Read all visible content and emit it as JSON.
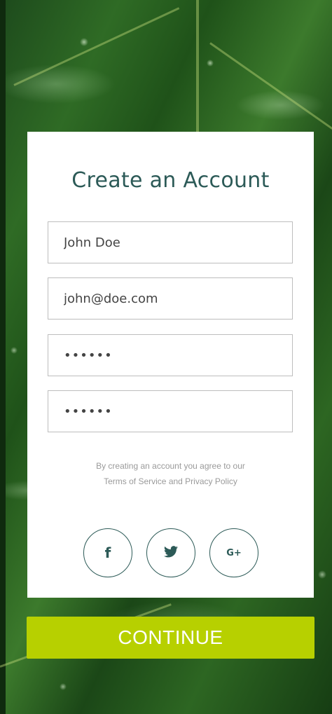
{
  "signup": {
    "title": "Create an Account",
    "fields": {
      "name": "John Doe",
      "email": "john@doe.com",
      "password": "••••••",
      "confirm_password": "••••••"
    },
    "terms_line1": "By creating an account you agree to our",
    "terms_line2": "Terms of Service and Privacy Policy",
    "social": {
      "facebook_glyph": "f",
      "twitter_icon": "twitter-icon",
      "google_glyph": "G+"
    },
    "continue_label": "CONTINUE"
  },
  "colors": {
    "accent": "#2c5a57",
    "button": "#b7d000"
  }
}
